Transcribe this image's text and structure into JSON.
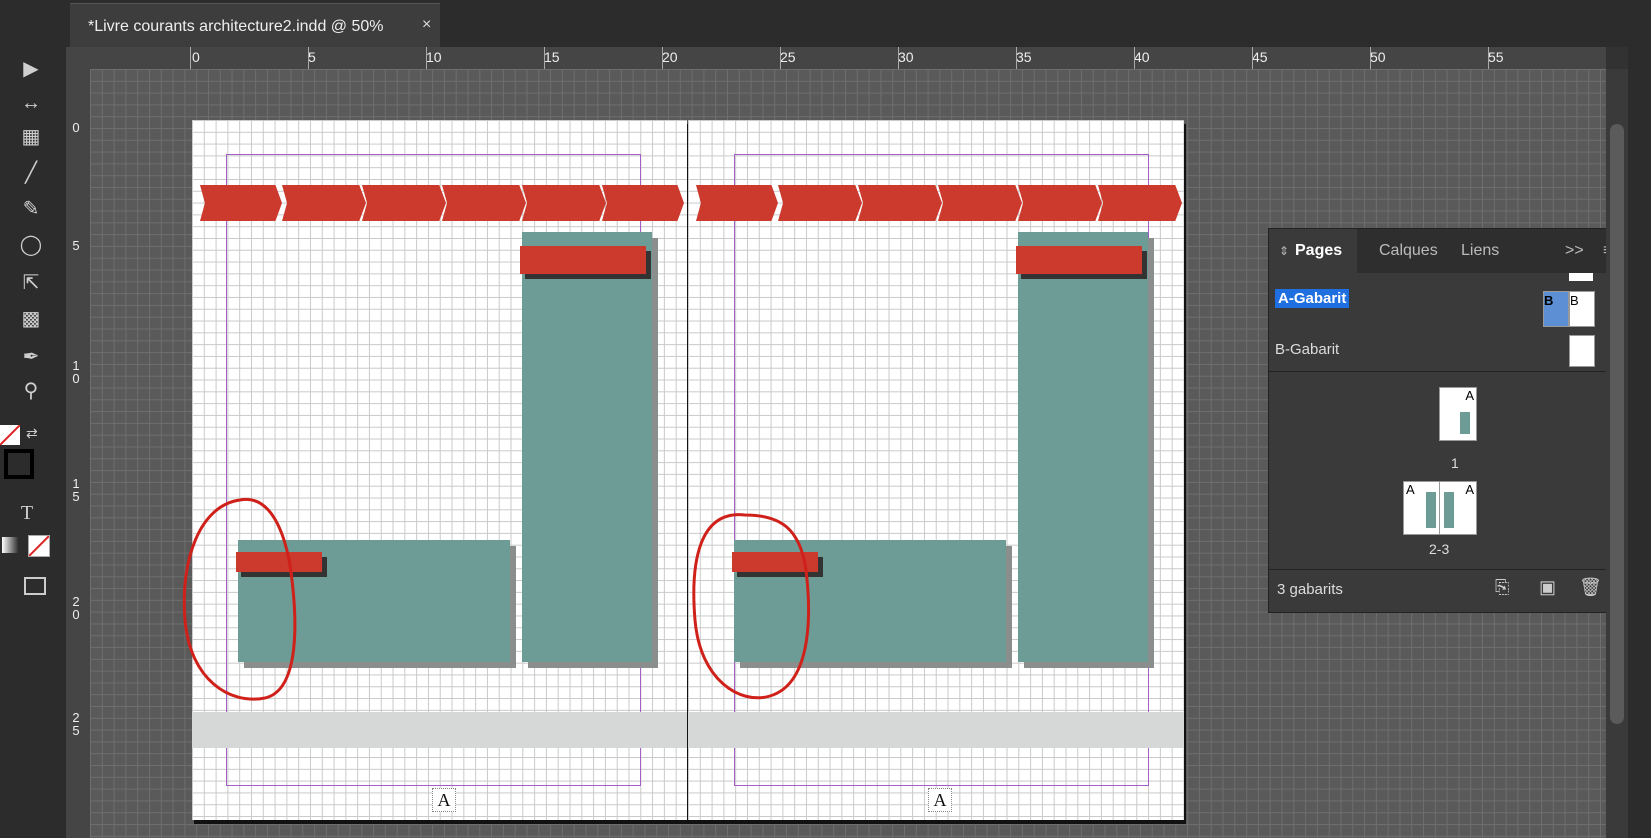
{
  "document": {
    "tab_title": "*Livre courants architecture2.indd @ 50%",
    "close_glyph": "×"
  },
  "rulers": {
    "horizontal": [
      "0",
      "5",
      "10",
      "15",
      "20",
      "25",
      "30",
      "35",
      "40",
      "45",
      "50",
      "55"
    ],
    "vertical": [
      "0",
      "5",
      "1\n0",
      "1\n5",
      "2\n0",
      "2\n5"
    ]
  },
  "tools": [
    {
      "name": "selection-tool",
      "icon": "arrow-icon",
      "glyph": "▶"
    },
    {
      "name": "gap-tool",
      "icon": "gap-icon",
      "glyph": "↔"
    },
    {
      "name": "content-collector-tool",
      "icon": "collector-icon",
      "glyph": "▦"
    },
    {
      "name": "line-tool",
      "icon": "line-icon",
      "glyph": "╱"
    },
    {
      "name": "pen-tool",
      "icon": "pen-icon",
      "glyph": "✎"
    },
    {
      "name": "ellipse-tool",
      "icon": "ellipse-icon",
      "glyph": "◯"
    },
    {
      "name": "free-transform-tool",
      "icon": "transform-icon",
      "glyph": "⇱"
    },
    {
      "name": "gradient-feather-tool",
      "icon": "gradient-icon",
      "glyph": "▩"
    },
    {
      "name": "eyedropper-tool",
      "icon": "eyedropper-icon",
      "glyph": "✒"
    },
    {
      "name": "zoom-tool",
      "icon": "zoom-icon",
      "glyph": "⚲"
    }
  ],
  "toolbar_extra": {
    "text_glyph": "T"
  },
  "page_markers": {
    "left": "A",
    "right": "A"
  },
  "panel": {
    "tabs": [
      {
        "label": "Pages",
        "active": true
      },
      {
        "label": "Calques",
        "active": false
      },
      {
        "label": "Liens",
        "active": false
      }
    ],
    "collapse_glyph": ">>",
    "menu_glyph": "≡",
    "sort_glyph": "⇕",
    "masters": [
      {
        "label": "A-Gabarit",
        "selected": true
      },
      {
        "label": "B-Gabarit",
        "selected": false
      }
    ],
    "master_thumb_letters": [
      "B",
      "B"
    ],
    "pages": [
      {
        "label": "1",
        "thumb_letter": "A"
      },
      {
        "label": "2-3",
        "thumb_letters": [
          "A",
          "A"
        ]
      }
    ],
    "footer_label": "3 gabarits"
  },
  "colors": {
    "accent_red": "#cc3a2d",
    "teal_block": "#6c9c95",
    "margin_guide": "#a45ec8",
    "selection_blue": "#1f6fe0"
  }
}
